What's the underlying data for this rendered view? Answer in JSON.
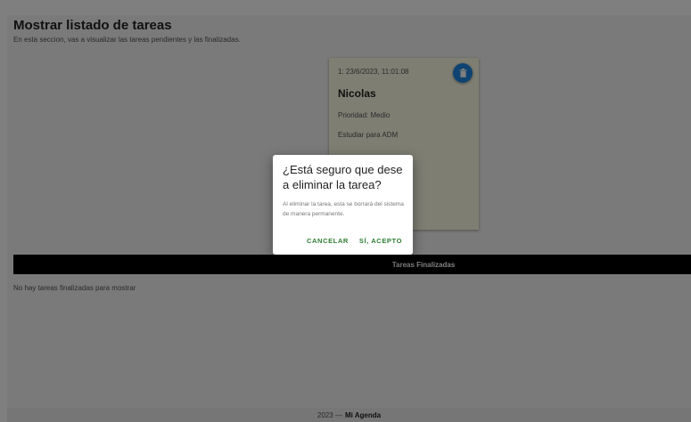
{
  "page": {
    "title": "Mostrar listado de tareas",
    "subtitle": "En esta seccion, vas a visualizar las tareas pendientes y las finalizadas."
  },
  "task_card": {
    "id_date": "1: 23/6/2023, 11:01:08",
    "name": "Nicolas",
    "priority": "Prioridad: Medio",
    "description": "Estudiar para ADM",
    "delete_icon": "trash-icon"
  },
  "finished_section": {
    "header": "Tareas Finalizadas",
    "empty_message": "No hay tareas finalizadas para mostrar"
  },
  "footer": {
    "year": "2023 —",
    "app_name": "Mi Agenda"
  },
  "dialog": {
    "title": "¿Está seguro que dese a eliminar la tarea?",
    "body": "Al eliminar la tarea, esta se borrará del sistema de manera permanente.",
    "cancel_label": "CANCELAR",
    "accept_label": "SÍ, ACEPTO"
  },
  "colors": {
    "accent_blue": "#1e88e5",
    "button_green": "#2e7d32",
    "card_background": "#fcfce6"
  }
}
